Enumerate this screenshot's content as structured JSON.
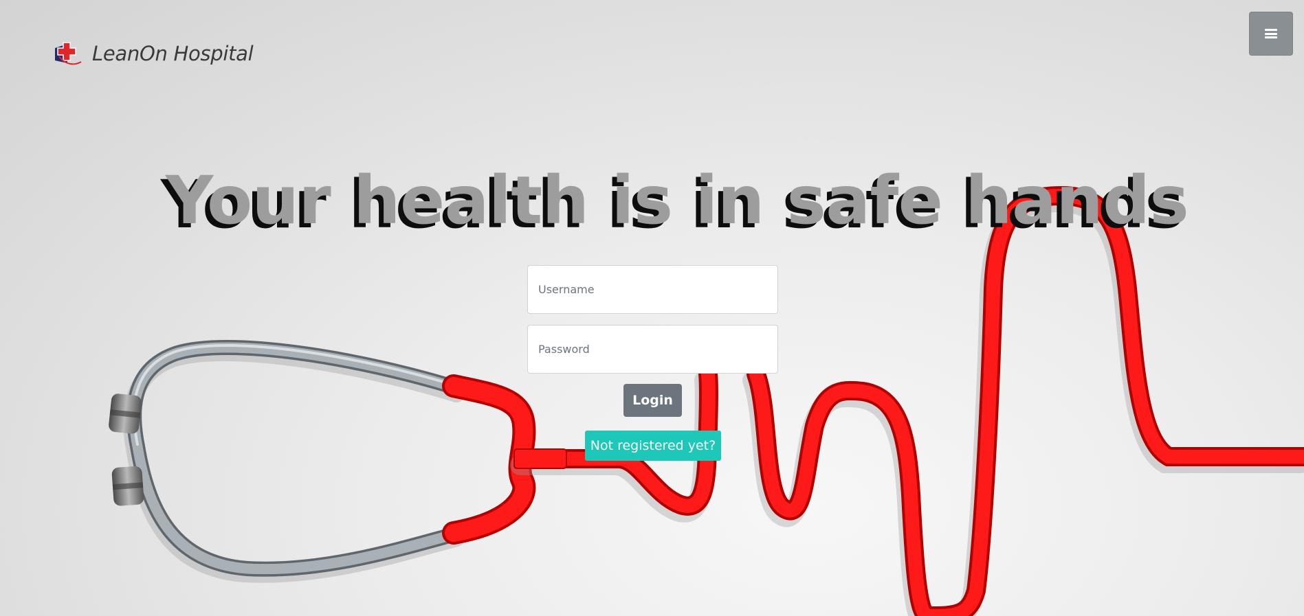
{
  "header": {
    "brand_name": "LeanOn Hospital",
    "logo_icon": "hospital-cross-logo",
    "menu_icon": "hamburger-menu-icon"
  },
  "hero": {
    "title": "Your health is in safe hands"
  },
  "login": {
    "username_placeholder": "Username",
    "password_placeholder": "Password",
    "login_label": "Login",
    "register_label": "Not registered yet?"
  },
  "colors": {
    "accent_teal": "#1dc8b8",
    "button_gray": "#6c757d",
    "stethoscope_red": "#ff1a1a",
    "brand_navy": "#1f2b6a"
  }
}
